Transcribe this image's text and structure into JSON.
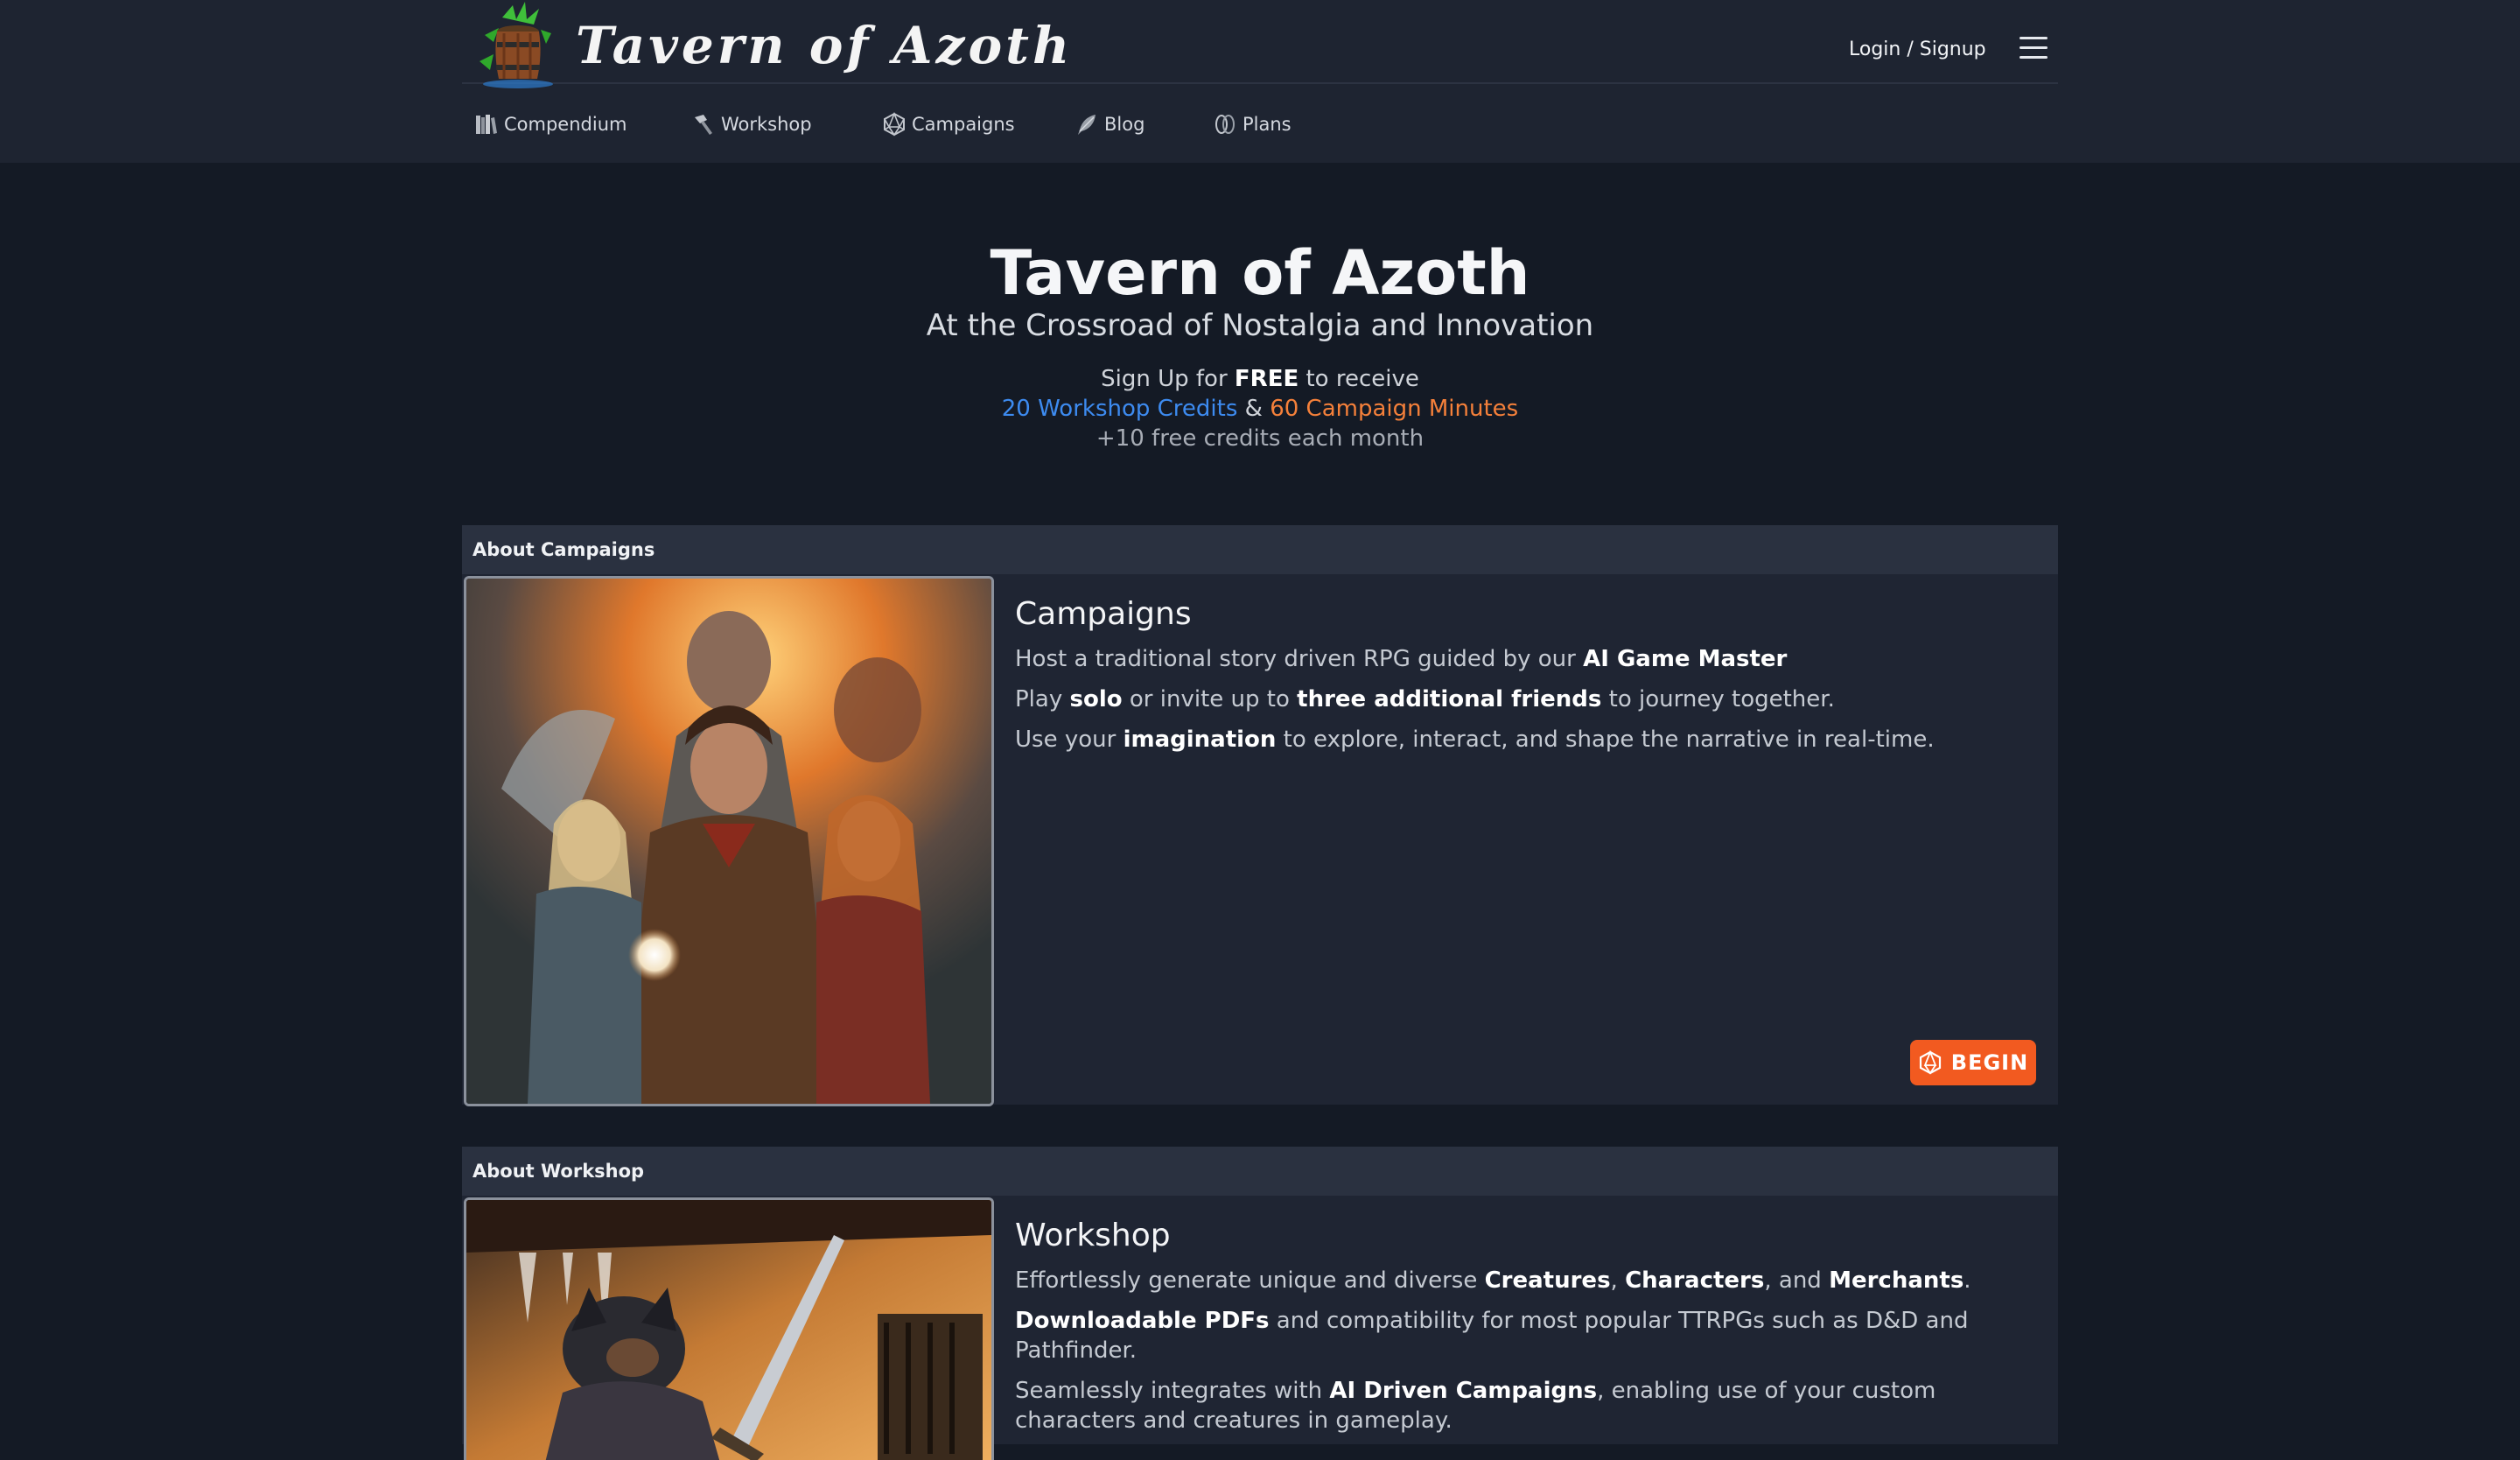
{
  "header": {
    "brand": "Tavern of Azoth",
    "login_label": "Login / Signup",
    "nav": [
      {
        "label": "Compendium",
        "icon": "books-icon"
      },
      {
        "label": "Workshop",
        "icon": "hammer-icon"
      },
      {
        "label": "Campaigns",
        "icon": "d20-icon"
      },
      {
        "label": "Blog",
        "icon": "quill-icon"
      },
      {
        "label": "Plans",
        "icon": "coins-icon"
      }
    ]
  },
  "hero": {
    "title": "Tavern of Azoth",
    "subtitle": "At the Crossroad of Nostalgia and Innovation",
    "cta_prefix": "Sign Up for ",
    "cta_free": "FREE",
    "cta_suffix": " to receive",
    "credits": "20 Workshop Credits",
    "amp": " & ",
    "minutes": "60 Campaign Minutes",
    "monthly": "+10 free credits each month"
  },
  "campaigns": {
    "header": "About Campaigns",
    "title": "Campaigns",
    "line1_a": "Host a traditional story driven RPG guided by our ",
    "line1_b": "AI Game Master",
    "line2_a": "Play ",
    "line2_b": "solo",
    "line2_c": " or invite up to ",
    "line2_d": "three additional friends",
    "line2_e": " to journey together.",
    "line3_a": "Use your ",
    "line3_b": "imagination",
    "line3_c": " to explore, interact, and shape the narrative in real-time.",
    "button": "BEGIN"
  },
  "workshop": {
    "header": "About Workshop",
    "title": "Workshop",
    "line1_a": "Effortlessly generate unique and diverse ",
    "line1_b": "Creatures",
    "line1_c": ", ",
    "line1_d": "Characters",
    "line1_e": ", and ",
    "line1_f": "Merchants",
    "line1_g": ".",
    "line2_a": "Downloadable PDFs",
    "line2_b": " and compatibility for most popular TTRPGs such as D&D and Pathfinder.",
    "line3_a": "Seamlessly integrates with ",
    "line3_b": "AI Driven Campaigns",
    "line3_c": ", enabling use of your custom characters and creatures in gameplay."
  },
  "colors": {
    "accent_blue": "#3d8bf0",
    "accent_orange": "#f5803a",
    "button": "#f25a20"
  }
}
